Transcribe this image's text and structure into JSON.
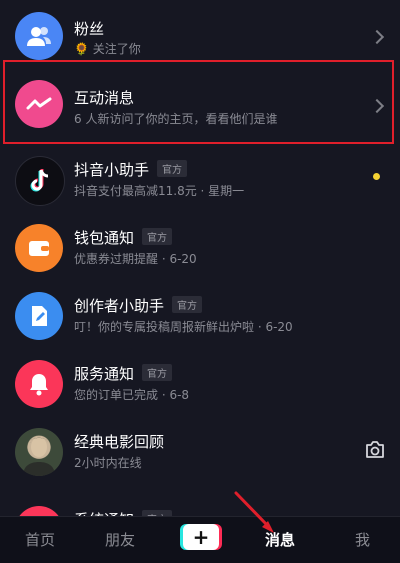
{
  "rows": [
    {
      "title": "粉丝",
      "sub": "关注了你"
    },
    {
      "title": "互动消息",
      "sub": "6 人新访问了你的主页，看看他们是谁"
    },
    {
      "title": "抖音小助手",
      "tag": "官方",
      "sub": "抖音支付最高减11.8元 · 星期一"
    },
    {
      "title": "钱包通知",
      "tag": "官方",
      "sub": "优惠券过期提醒 · 6-20"
    },
    {
      "title": "创作者小助手",
      "tag": "官方",
      "sub": "叮！你的专属投稿周报新鲜出炉啦 · 6-20"
    },
    {
      "title": "服务通知",
      "tag": "官方",
      "sub": "您的订单已完成 · 6-8"
    },
    {
      "title": "经典电影回顾",
      "sub": "2小时内在线"
    },
    {
      "title": "系统通知",
      "tag": "官方"
    }
  ],
  "tabs": {
    "home": "首页",
    "friends": "朋友",
    "create": "+",
    "messages": "消息",
    "me": "我"
  },
  "colors": {
    "fans": "#4a86f5",
    "interact": "#f04a8e",
    "douyin": "#0d0d13",
    "wallet": "#f7822a",
    "creator": "#3b8df0",
    "service": "#fb3659",
    "highlight": "#e01f2b",
    "unread_dot": "#f5d233"
  }
}
